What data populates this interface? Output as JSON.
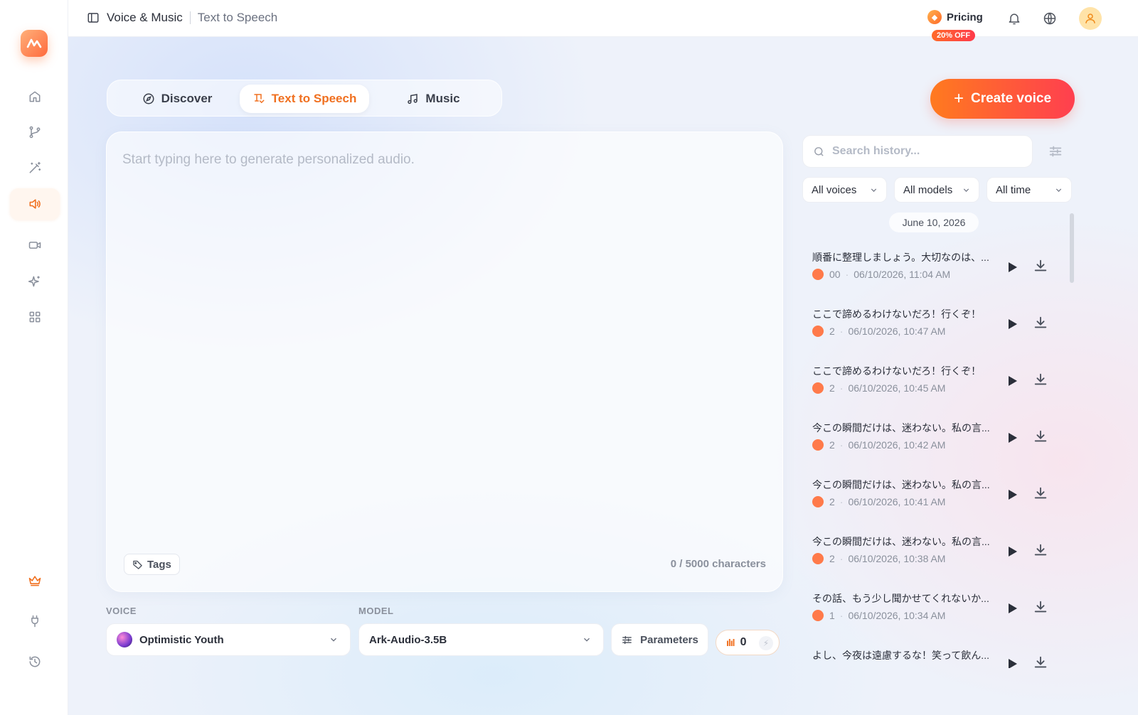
{
  "topbar": {
    "breadcrumb_section": "Voice & Music",
    "breadcrumb_page": "Text to Speech",
    "pricing_label": "Pricing",
    "pricing_badge": "20% OFF"
  },
  "tabs": [
    {
      "label": "Discover"
    },
    {
      "label": "Text to Speech",
      "active": true
    },
    {
      "label": "Music"
    }
  ],
  "create_button_label": "Create voice",
  "editor": {
    "placeholder": "Start typing here to generate personalized audio.",
    "value": "",
    "tags_label": "Tags",
    "char_count": "0 / 5000 characters"
  },
  "controls": {
    "voice_label": "VOICE",
    "voice_value": "Optimistic Youth",
    "model_label": "MODEL",
    "model_value": "Ark-Audio-3.5B",
    "parameters_label": "Parameters",
    "credits": "0"
  },
  "history_panel": {
    "search_placeholder": "Search history...",
    "filters": [
      "All voices",
      "All models",
      "All time"
    ],
    "date_group": "June 10, 2026",
    "items": [
      {
        "text": "順番に整理しましょう。大切なのは、...",
        "count": "00",
        "timestamp": "06/10/2026, 11:04 AM"
      },
      {
        "text": "ここで諦めるわけないだろ！行くぞ！",
        "count": "2",
        "timestamp": "06/10/2026, 10:47 AM"
      },
      {
        "text": "ここで諦めるわけないだろ！行くぞ！",
        "count": "2",
        "timestamp": "06/10/2026, 10:45 AM"
      },
      {
        "text": "今この瞬間だけは、迷わない。私の言...",
        "count": "2",
        "timestamp": "06/10/2026, 10:42 AM"
      },
      {
        "text": "今この瞬間だけは、迷わない。私の言...",
        "count": "2",
        "timestamp": "06/10/2026, 10:41 AM"
      },
      {
        "text": "今この瞬間だけは、迷わない。私の言...",
        "count": "2",
        "timestamp": "06/10/2026, 10:38 AM"
      },
      {
        "text": "その話、もう少し聞かせてくれないか...",
        "count": "1",
        "timestamp": "06/10/2026, 10:34 AM"
      },
      {
        "text": "よし、今夜は遠慮するな！笑って飲ん...",
        "count": "",
        "timestamp": ""
      }
    ]
  },
  "colors": {
    "accent": "#f07020",
    "gradient_start": "#ff7a1f",
    "gradient_end": "#ff3f4f",
    "voice_dot": "#ff7a4a"
  },
  "sidebar_icons": [
    "home-icon",
    "branch-icon",
    "magic-wand-icon",
    "speaker-icon",
    "video-icon",
    "sparkles-icon",
    "grid-icon",
    "crown-icon",
    "plug-icon",
    "history-icon"
  ]
}
